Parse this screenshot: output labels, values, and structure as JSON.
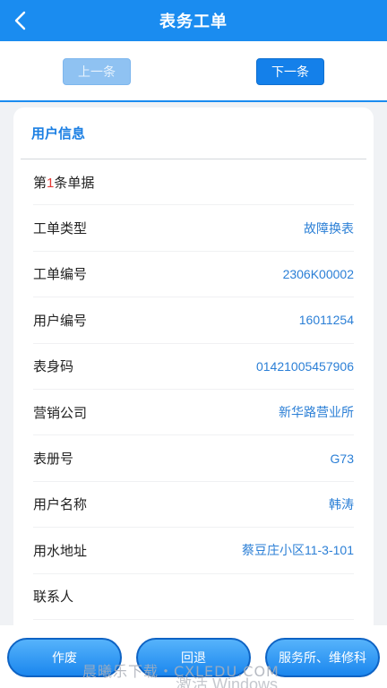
{
  "header": {
    "title": "表务工单",
    "back_icon": "chevron-left-icon"
  },
  "nav": {
    "prev_label": "上一条",
    "next_label": "下一条"
  },
  "card": {
    "title": "用户信息",
    "record": {
      "prefix": "第",
      "number": "1",
      "suffix": "条单据"
    },
    "rows": [
      {
        "label": "工单类型",
        "value": "故障换表"
      },
      {
        "label": "工单编号",
        "value": "2306K00002"
      },
      {
        "label": "用户编号",
        "value": "16011254"
      },
      {
        "label": "表身码",
        "value": "01421005457906"
      },
      {
        "label": "营销公司",
        "value": "新华路营业所"
      },
      {
        "label": "表册号",
        "value": "G73"
      },
      {
        "label": "用户名称",
        "value": "韩涛"
      },
      {
        "label": "用水地址",
        "value": "蔡豆庄小区11-3-101"
      },
      {
        "label": "联系人",
        "value": ""
      }
    ]
  },
  "actions": {
    "void_label": "作废",
    "return_label": "回退",
    "service_label": "服务所、维修科"
  },
  "overlay": {
    "watermark": "晨曦乐下载・CXLEDU.COM",
    "activate": "激活 Windows"
  },
  "colors": {
    "primary": "#1a8cf0",
    "value_text": "#2b7fd6",
    "title_text": "#1b7fe3",
    "highlight": "#e53935"
  }
}
